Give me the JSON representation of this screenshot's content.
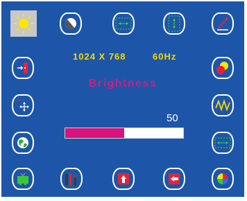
{
  "menu": {
    "resolution": "1024 X 768",
    "refresh_rate": "60Hz",
    "title": "Brightness",
    "value": "50",
    "level_fraction": 0.5,
    "selected_icon": "brightness-icon"
  },
  "colors": {
    "background": "#1d56a8",
    "info_text": "#f5d800",
    "title_text": "#cc1e84",
    "bar_fill": "#d8137e",
    "bar_track": "#ffffff"
  },
  "icons": {
    "top_row": [
      "brightness-icon",
      "contrast-icon",
      "horizontal-position-icon",
      "vertical-position-icon",
      "color-temperature-icon"
    ],
    "left_column": [
      "input-source-icon",
      "osd-position-icon",
      "language-icon"
    ],
    "right_column": [
      "color-adjust-icon",
      "phase-icon",
      "horizontal-size-icon"
    ],
    "bottom_row": [
      "tv-icon",
      "tools-icon",
      "recall-icon",
      "exit-icon",
      "color-palette-icon"
    ]
  }
}
